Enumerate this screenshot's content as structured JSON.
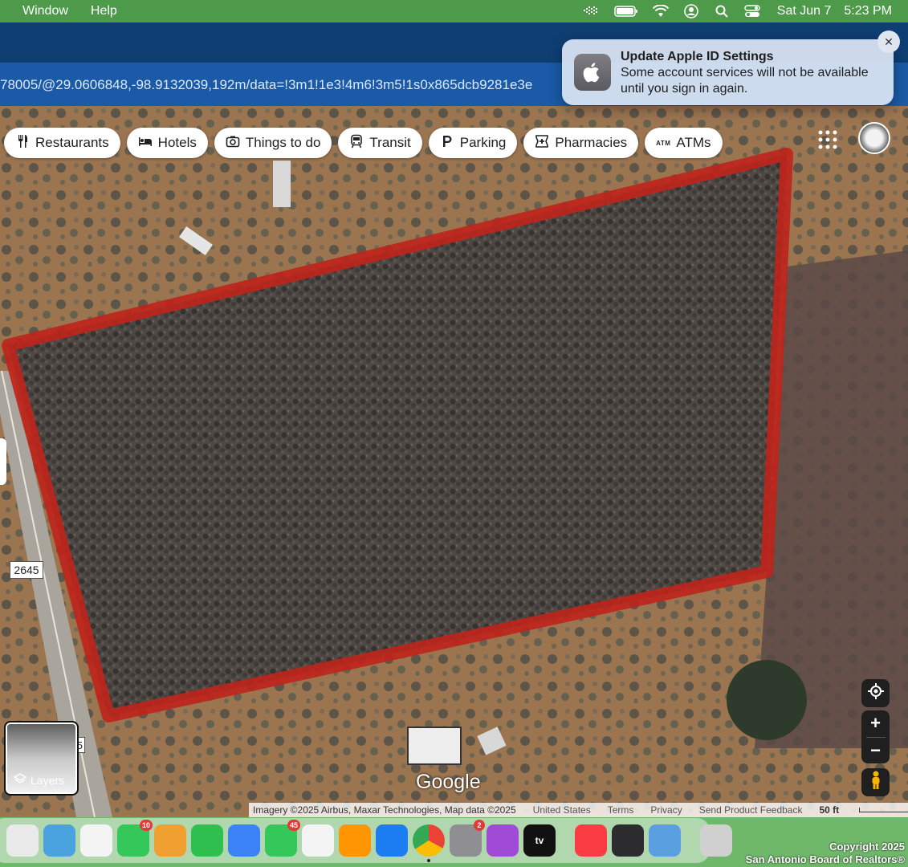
{
  "menubar": {
    "items": [
      "Window",
      "Help"
    ],
    "date": "Sat Jun 7",
    "time": "5:23 PM",
    "status_icons": [
      "grid-icon",
      "battery-icon",
      "wifi-icon",
      "user-icon",
      "search-icon",
      "control-center-icon"
    ]
  },
  "browser": {
    "url_text": "78005/@29.0606848,-98.9132039,192m/data=!3m1!1e3!4m6!3m5!1s0x865dcb9281e3e"
  },
  "notification": {
    "title": "Update Apple ID Settings",
    "body": "Some account services will not be available until you sign in again.",
    "close_label": "✕"
  },
  "map": {
    "chips": [
      {
        "label": "Restaurants",
        "icon": "fork-knife-icon"
      },
      {
        "label": "Hotels",
        "icon": "bed-icon"
      },
      {
        "label": "Things to do",
        "icon": "camera-icon"
      },
      {
        "label": "Transit",
        "icon": "train-icon"
      },
      {
        "label": "Parking",
        "icon": "parking-icon"
      },
      {
        "label": "Pharmacies",
        "icon": "pharmacy-icon"
      },
      {
        "label": "ATMs",
        "icon": "atm-icon"
      }
    ],
    "road_label": "2645",
    "road_label_partial": "5",
    "layers_label": "Layers",
    "google_logo": "Google",
    "zoom_in": "+",
    "zoom_out": "−",
    "attribution": {
      "imagery": "Imagery ©2025 Airbus, Maxar Technologies, Map data ©2025",
      "country": "United States",
      "terms": "Terms",
      "privacy": "Privacy",
      "feedback": "Send Product Feedback",
      "scale": "50 ft"
    },
    "parcel_outline_color": "#c0231b"
  },
  "dock": {
    "apps": [
      {
        "name": "finder",
        "color": "#eaeaea"
      },
      {
        "name": "maps",
        "color": "#4aa3df"
      },
      {
        "name": "photos",
        "color": "#f4f4f4"
      },
      {
        "name": "facetime",
        "color": "#34c759",
        "badge": "10"
      },
      {
        "name": "pages",
        "color": "#f0a030"
      },
      {
        "name": "numbers",
        "color": "#2fbf4f"
      },
      {
        "name": "keynote",
        "color": "#3b82f6"
      },
      {
        "name": "messages",
        "color": "#34c759",
        "badge": "45"
      },
      {
        "name": "news",
        "color": "#f4f4f4"
      },
      {
        "name": "books",
        "color": "#ff9500"
      },
      {
        "name": "app-store",
        "color": "#1c7cf2"
      },
      {
        "name": "chrome",
        "color": "#ffffff"
      },
      {
        "name": "system-settings",
        "color": "#8e8e93",
        "badge": "2"
      },
      {
        "name": "podcasts",
        "color": "#a04ad8"
      },
      {
        "name": "apple-tv",
        "color": "#111111",
        "text": "tv"
      },
      {
        "name": "music",
        "color": "#fc3c44"
      },
      {
        "name": "quicktime",
        "color": "#2c2c2e"
      },
      {
        "name": "preview",
        "color": "#5aa0e0"
      },
      {
        "name": "trash",
        "color": "#d0d0d0"
      }
    ]
  },
  "watermark": {
    "line1": "Copyright 2025",
    "line2": "San Antonio Board of Realtors®"
  }
}
